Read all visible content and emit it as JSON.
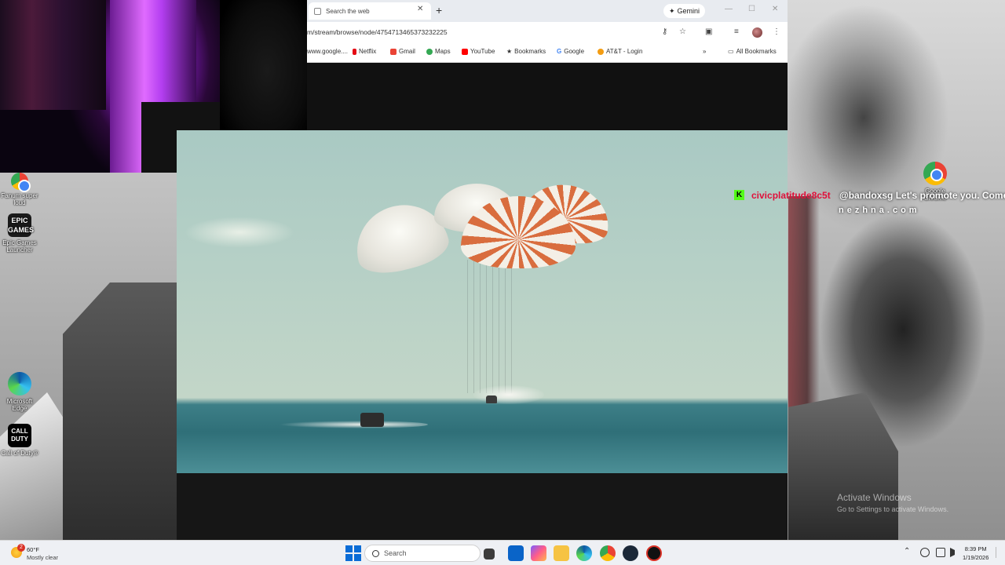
{
  "browser": {
    "tab_title": "Search the web",
    "gemini_label": "Gemini",
    "url": "m/stream/browse/node/4754713465373232225",
    "bookmarks": [
      {
        "label": "www.google....",
        "color": "#4285f4"
      },
      {
        "label": "Netflix",
        "color": "#e50914"
      },
      {
        "label": "Gmail",
        "color": "#ea4335"
      },
      {
        "label": "Maps",
        "color": "#34a853"
      },
      {
        "label": "YouTube",
        "color": "#ff0000"
      },
      {
        "label": "Bookmarks",
        "color": "#555555"
      },
      {
        "label": "Google",
        "color": "#4285f4"
      },
      {
        "label": "AT&T - Login",
        "color": "#f39c12"
      }
    ],
    "more_label": "»",
    "all_bookmarks": "All Bookmarks"
  },
  "desktop_icons": [
    {
      "label": "Fanum super loud",
      "icon": "chrome-icon"
    },
    {
      "label": "Epic Games Launcher",
      "icon": "epic-games-icon"
    },
    {
      "label": "Microsoft Edge",
      "icon": "edge-icon"
    },
    {
      "label": "Call of Duty®",
      "icon": "call-of-duty-icon"
    }
  ],
  "desktop_right_icon": {
    "label": "Google Chrome",
    "icon": "chrome-icon"
  },
  "chat": {
    "badge": "K",
    "username": "civicplatitude8c5t",
    "message": "@bandoxsg Let's promote you. Come",
    "subline": "nezhna.com"
  },
  "watermark": {
    "title": "Activate Windows",
    "subtitle": "Go to Settings to activate Windows."
  },
  "taskbar": {
    "weather_badge": "2",
    "temperature": "60°F",
    "condition": "Mostly clear",
    "search_placeholder": "Search",
    "time": "8:39 PM",
    "date": "1/19/2026"
  },
  "colors": {
    "chat_username": "#e0103a",
    "chat_badge": "#53fc18",
    "accent": "#0a6cd6"
  }
}
